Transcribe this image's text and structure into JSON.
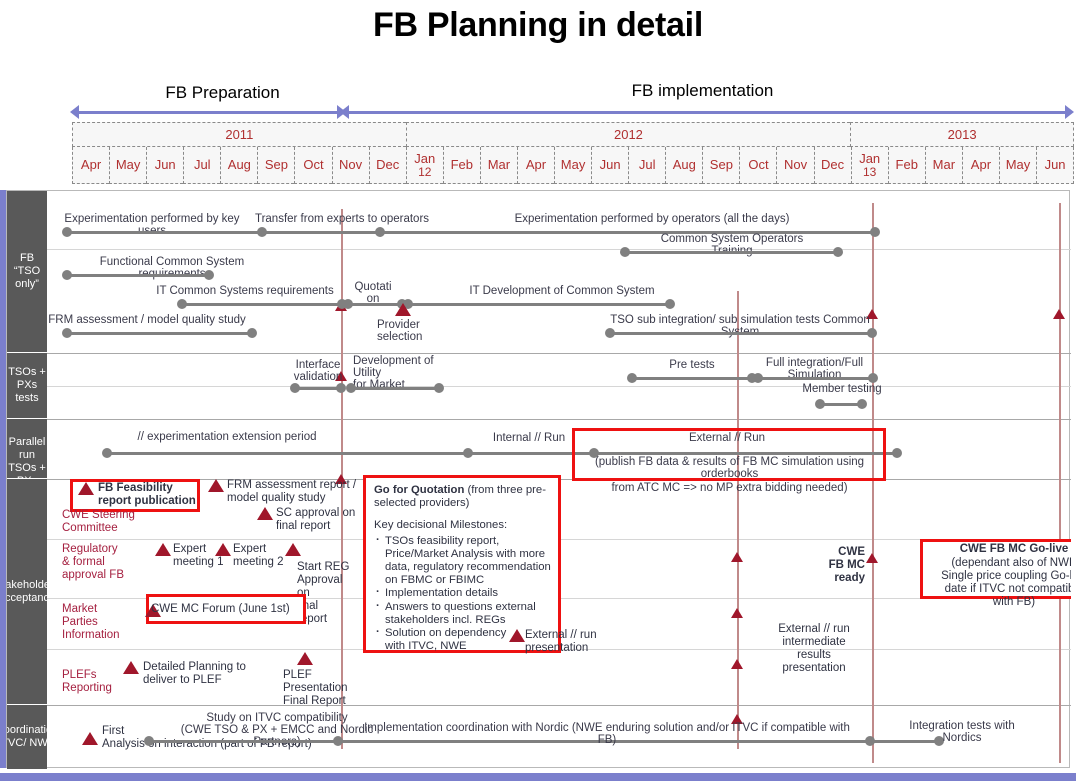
{
  "title": "FB Planning in detail",
  "phases": [
    {
      "label": "FB Preparation"
    },
    {
      "label": "FB implementation"
    }
  ],
  "calendar": {
    "years": [
      {
        "label": "2011",
        "months": 9
      },
      {
        "label": "2012",
        "months": 12
      },
      {
        "label": "2013",
        "months": 6
      }
    ],
    "months": [
      {
        "label": "Apr"
      },
      {
        "label": "May"
      },
      {
        "label": "Jun"
      },
      {
        "label": "Jul"
      },
      {
        "label": "Aug"
      },
      {
        "label": "Sep"
      },
      {
        "label": "Oct"
      },
      {
        "label": "Nov"
      },
      {
        "label": "Dec"
      },
      {
        "label": "Jan",
        "sub": "12"
      },
      {
        "label": "Feb"
      },
      {
        "label": "Mar"
      },
      {
        "label": "Apr"
      },
      {
        "label": "May"
      },
      {
        "label": "Jun"
      },
      {
        "label": "Jul"
      },
      {
        "label": "Aug"
      },
      {
        "label": "Sep"
      },
      {
        "label": "Oct"
      },
      {
        "label": "Nov"
      },
      {
        "label": "Dec"
      },
      {
        "label": "Jan",
        "sub": "13"
      },
      {
        "label": "Feb"
      },
      {
        "label": "Mar"
      },
      {
        "label": "Apr"
      },
      {
        "label": "May"
      },
      {
        "label": "Jun"
      }
    ]
  },
  "bands": [
    {
      "label": "FB “TSO only”"
    },
    {
      "label": "TSOs + PXs tests"
    },
    {
      "label": "Parallel run TSOs + PXs"
    },
    {
      "label": "Stakeholders acceptance"
    },
    {
      "label": "Coordination iTVC/ NWE"
    }
  ],
  "bars": [
    {
      "label": "Experimentation performed by key users"
    },
    {
      "label": "Transfer from experts to operators"
    },
    {
      "label": "Experimentation performed by operators (all the days)"
    },
    {
      "label": "Common System Operators\nTraining"
    },
    {
      "label": "Functional Common System\nrequirements"
    },
    {
      "label": "IT Common Systems requirements"
    },
    {
      "label": "Quotati\non"
    },
    {
      "label": "IT Development of Common System"
    },
    {
      "label": "FRM assessment / model quality study"
    },
    {
      "label": "TSO sub integration/ sub simulation tests Common System"
    },
    {
      "label": "Interface\nvalidation"
    },
    {
      "label": "Development of\nUtility\nfor Market"
    },
    {
      "label": "Pre tests"
    },
    {
      "label": "Full integration/Full\nSimulation"
    },
    {
      "label": "Member testing"
    },
    {
      "label": "// experimentation extension period"
    },
    {
      "label": "Internal  //  Run"
    },
    {
      "label": "External // Run"
    },
    {
      "label": "Study on ITVC compatibility\n(CWE TSO & PX + EMCC and Nordic\nPartners)"
    },
    {
      "label": "Implementation coordination with Nordic (NWE enduring solution and/or ITVC if compatible with FB)"
    },
    {
      "label": "Integration tests with\nNordics"
    }
  ],
  "milestones": [
    {
      "label": "Provider\nselection"
    },
    {
      "label": "FB Feasibility\nreport publication"
    },
    {
      "label": "FRM assessment report /\nmodel quality study"
    },
    {
      "label": "SC approval on\nfinal report"
    },
    {
      "label": "Expert\nmeeting 1"
    },
    {
      "label": "Expert\nmeeting 2"
    },
    {
      "label": "Start REG\nApproval\non\nfinal\nreport"
    },
    {
      "label": "CWE MC Forum (June 1st)"
    },
    {
      "label": "Detailed Planning to\ndeliver to PLEF"
    },
    {
      "label": "PLEF\nPresentation\nFinal Report"
    },
    {
      "label": "External  //  run\npresentation"
    },
    {
      "label": "External // run\nintermediate\nresults\npresentation"
    },
    {
      "label": "CWE\nFB MC\nready"
    },
    {
      "label": "First\nAnalysis on interaction (part of FB report)"
    }
  ],
  "row_titles": [
    {
      "label": "CWE Steering\nCommittee"
    },
    {
      "label": "Regulatory\n& formal\napproval FB"
    },
    {
      "label": "Market\nParties\nInformation"
    },
    {
      "label": "PLEFs\nReporting"
    }
  ],
  "callouts": {
    "quotation": {
      "heading_bold": "Go for Quotation",
      "heading_rest": " (from three pre-selected providers)",
      "milestones_title": "Key decisional Milestones:",
      "items": [
        "TSOs feasibility report, Price/Market Analysis with more data, regulatory recommendation on FBMC or FBIMC",
        "Implementation details",
        "Answers to questions external stakeholders incl. REGs",
        "Solution on dependency\n with ITVC, NWE"
      ]
    },
    "external_run": {
      "title": "External // Run",
      "note": "(publish FB data & results of FB MC simulation using orderbooks",
      "note2": "from  ATC MC => no MP extra bidding needed)"
    },
    "golive": {
      "title": "CWE FB MC Go-live",
      "body": "(dependant also of NWE\nSingle price coupling Go-live\ndate if ITVC not compatible\nwith FB)"
    }
  },
  "colors": {
    "accent_purple": "#7b7fcc",
    "milestone_red": "#A0172B",
    "highlight_red": "#ee1111",
    "band_gray": "#595959",
    "bar_gray": "#808080",
    "year_text": "#b03030"
  }
}
